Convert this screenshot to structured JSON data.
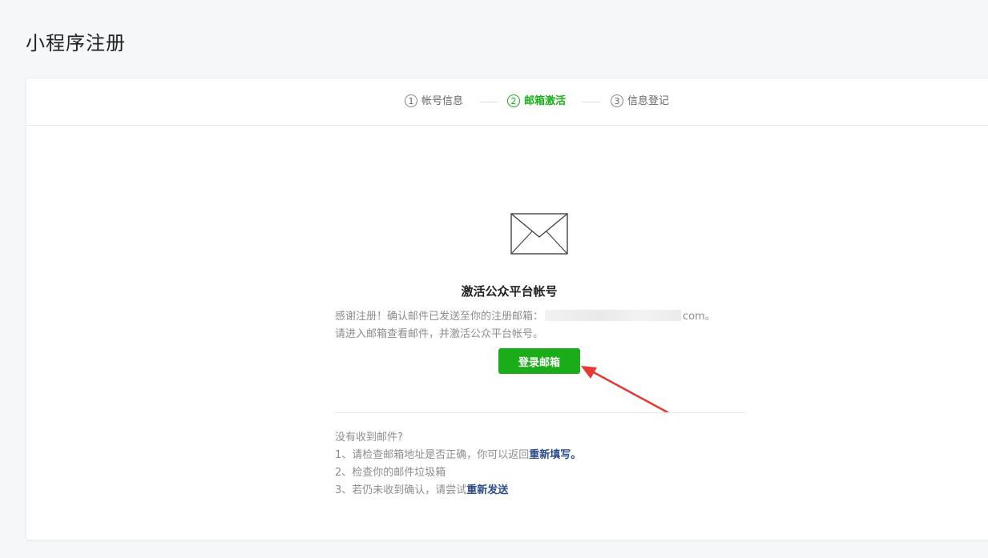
{
  "page": {
    "title": "小程序注册"
  },
  "steps": [
    {
      "num": "1",
      "label": "帐号信息",
      "state": "done"
    },
    {
      "num": "2",
      "label": "邮箱激活",
      "state": "active"
    },
    {
      "num": "3",
      "label": "信息登记",
      "state": "pending"
    }
  ],
  "colors": {
    "accent": "#1aad19",
    "link": "#2b4c8a",
    "arrow": "#e53935"
  },
  "activation": {
    "icon": "envelope-icon",
    "headline": "激活公众平台帐号",
    "line1_prefix": "感谢注册！确认邮件已发送至你的注册邮箱：",
    "email_suffix": "com。",
    "line2": "请进入邮箱查看邮件，并激活公众平台帐号。",
    "login_button": "登录邮箱"
  },
  "help": {
    "title": "没有收到邮件?",
    "item1_prefix": "1、请检查邮箱地址是否正确，你可以返回",
    "item1_link": "重新填写。",
    "item2": "2、检查你的邮件垃圾箱",
    "item3_prefix": "3、若仍未收到确认，请尝试",
    "item3_link": "重新发送"
  }
}
